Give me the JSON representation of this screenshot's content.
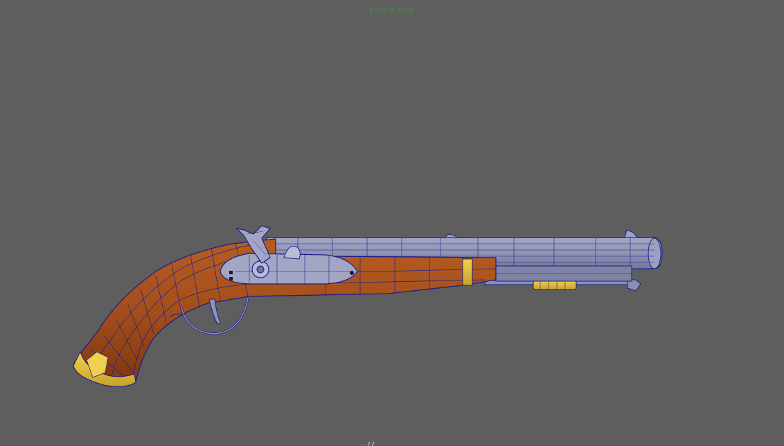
{
  "viewport": {
    "background_color": "#5e5e5e",
    "resolution_gate_label": "1500 x 1500",
    "resolution_gate_label_color": "#3f9a3f"
  },
  "model": {
    "name": "flintlock-pistol",
    "display_mode": "wireframe-on-shaded",
    "wireframe_color": "#1d1d8a",
    "materials": {
      "wood": "#a8501c",
      "wood_dark": "#7a3512",
      "metal": "#8e93b3",
      "metal_light": "#b7bbd4",
      "brass": "#e2c23a"
    }
  },
  "view_axis_icon": "view-axis-icon"
}
